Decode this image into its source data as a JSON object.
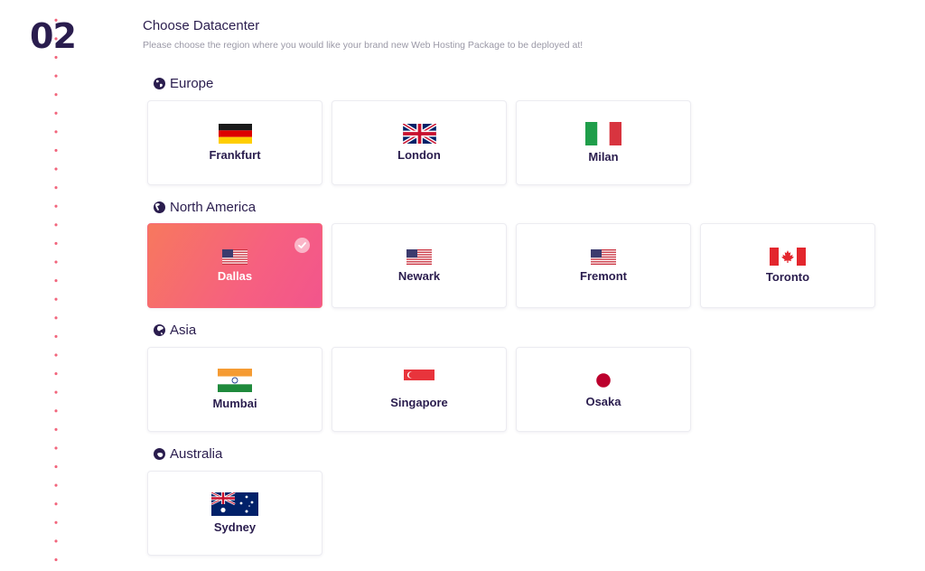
{
  "step": {
    "number": "02"
  },
  "header": {
    "title": "Choose Datacenter",
    "subtitle": "Please choose the region where you would like your brand new Web Hosting Package to be deployed at!"
  },
  "colors": {
    "accent": "#f66080",
    "text": "#2a1d4e",
    "dots": "#f2657c"
  },
  "regions": [
    {
      "name": "Europe",
      "locations": [
        {
          "city": "Frankfurt",
          "flag": "germany-flag-icon"
        },
        {
          "city": "London",
          "flag": "uk-flag-icon"
        },
        {
          "city": "Milan",
          "flag": "italy-flag-icon"
        }
      ]
    },
    {
      "name": "North America",
      "locations": [
        {
          "city": "Dallas",
          "flag": "usa-flag-icon",
          "selected": true
        },
        {
          "city": "Newark",
          "flag": "usa-flag-icon"
        },
        {
          "city": "Fremont",
          "flag": "usa-flag-icon"
        },
        {
          "city": "Toronto",
          "flag": "canada-flag-icon"
        }
      ]
    },
    {
      "name": "Asia",
      "locations": [
        {
          "city": "Mumbai",
          "flag": "india-flag-icon"
        },
        {
          "city": "Singapore",
          "flag": "singapore-flag-icon"
        },
        {
          "city": "Osaka",
          "flag": "japan-flag-icon"
        }
      ]
    },
    {
      "name": "Australia",
      "locations": [
        {
          "city": "Sydney",
          "flag": "australia-flag-icon"
        }
      ]
    }
  ]
}
